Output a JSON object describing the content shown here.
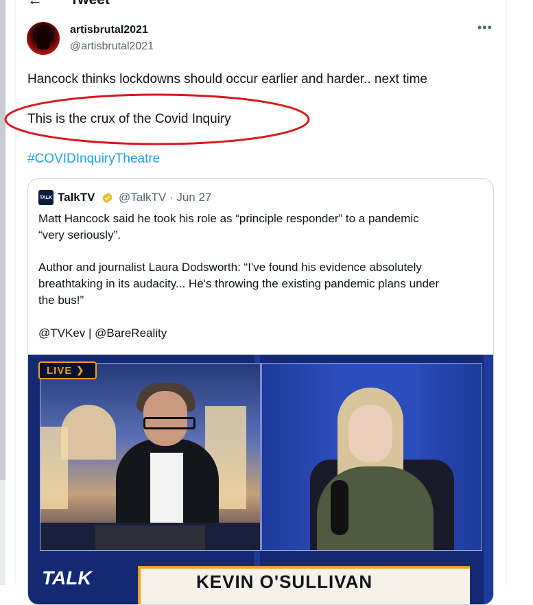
{
  "header": {
    "title": "Tweet",
    "back_icon": "arrow-left-icon"
  },
  "author": {
    "display_name": "artisbrutal2021",
    "handle": "@artisbrutal2021"
  },
  "tweet": {
    "line1": "Hancock thinks lockdowns should occur earlier and harder.. next time",
    "line2": "This is the crux of the Covid Inquiry",
    "hashtag": "#COVIDInquiryTheatre"
  },
  "quote": {
    "logo_text": "TALK",
    "name": "TalkTV",
    "meta": "@TalkTV · Jun 27",
    "lines": [
      "Matt Hancock said he took his role as “principle responder” to a pandemic",
      "“very seriously”.",
      "Author and journalist Laura Dodsworth: “I've found his evidence absolutely",
      "breathtaking in its audacity... He's throwing the existing pandemic plans under",
      "the bus!”",
      "@TVKev | @BareReality"
    ],
    "media": {
      "live_label": "LIVE",
      "logo": "TALK",
      "presenter": "KEVIN O'SULLIVAN"
    }
  },
  "colors": {
    "link": "#1d9bf0",
    "annotation": "#d7191f",
    "live": "#f2a01e"
  }
}
